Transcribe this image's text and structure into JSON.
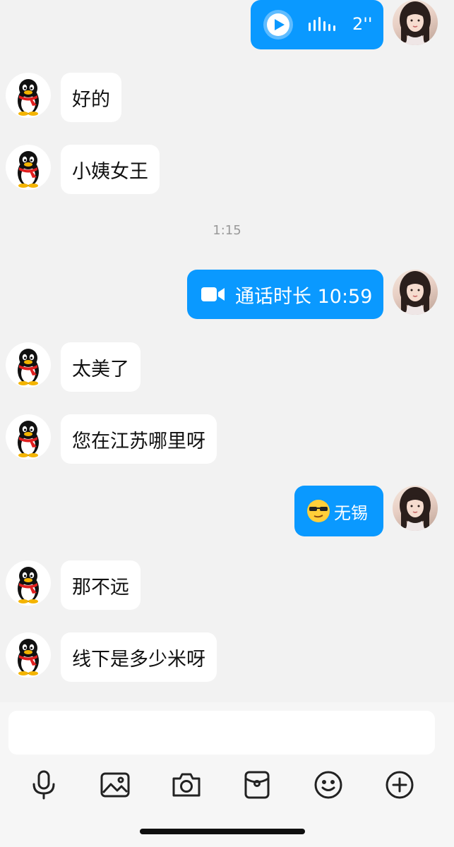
{
  "messages": [
    {
      "side": "out",
      "type": "voice",
      "duration": "2''"
    },
    {
      "side": "in",
      "text": "好的"
    },
    {
      "side": "in",
      "text": "小姨女王"
    },
    {
      "side": "time",
      "text": "1:15"
    },
    {
      "side": "out",
      "type": "call",
      "text": "通话时长 10:59"
    },
    {
      "side": "in",
      "text": "太美了"
    },
    {
      "side": "in",
      "text": "您在江苏哪里呀"
    },
    {
      "side": "out",
      "type": "emoji-text",
      "text": "无锡"
    },
    {
      "side": "in",
      "text": "那不远"
    },
    {
      "side": "in",
      "text": "线下是多少米呀"
    }
  ],
  "composer": {
    "input_placeholder": "",
    "tools": [
      "microphone-icon",
      "image-icon",
      "camera-icon",
      "red-packet-icon",
      "emoji-icon",
      "plus-icon"
    ]
  },
  "colors": {
    "outgoing_bubble": "#0a99ff",
    "incoming_bubble": "#ffffff",
    "background": "#f2f2f2"
  }
}
